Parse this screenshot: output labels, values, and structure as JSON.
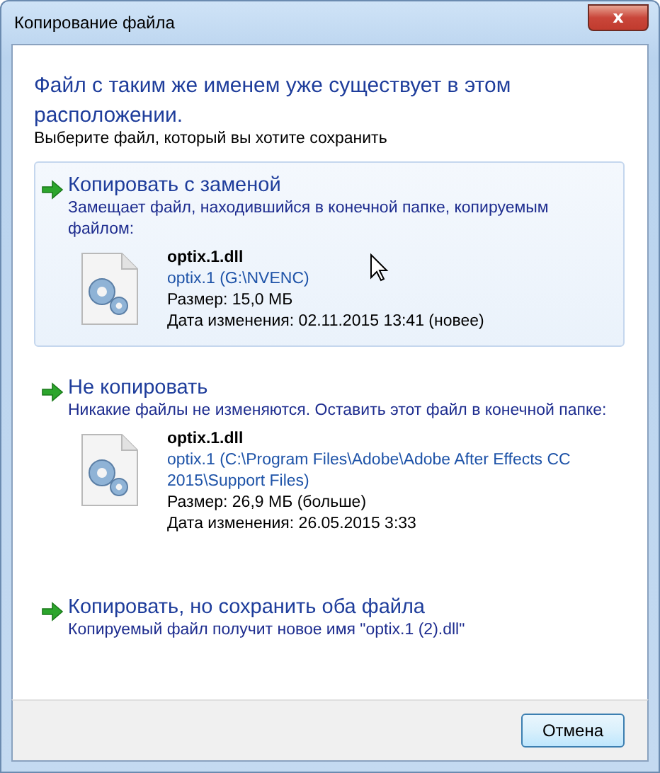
{
  "window": {
    "title": "Копирование файла",
    "close_label": "x"
  },
  "heading": "Файл с таким же именем уже существует в этом расположении.",
  "instruction": "Выберите файл, который вы хотите сохранить",
  "options": [
    {
      "title": "Копировать с заменой",
      "description": "Замещает файл, находившийся в конечной папке, копируемым файлом:",
      "selected": true,
      "file": {
        "name": "optix.1.dll",
        "location": "optix.1 (G:\\NVENC)",
        "size": "Размер: 15,0 МБ",
        "date": "Дата изменения: 02.11.2015 13:41 (новее)"
      }
    },
    {
      "title": "Не копировать",
      "description": "Никакие файлы не изменяются. Оставить этот файл в конечной папке:",
      "selected": false,
      "file": {
        "name": "optix.1.dll",
        "location": "optix.1 (C:\\Program Files\\Adobe\\Adobe After Effects CC 2015\\Support Files)",
        "size": "Размер: 26,9 МБ (больше)",
        "date": "Дата изменения: 26.05.2015 3:33"
      }
    },
    {
      "title": "Копировать, но сохранить оба файла",
      "description": "Копируемый файл получит новое имя \"optix.1 (2).dll\"",
      "selected": false
    }
  ],
  "cancel_button": "Отмена"
}
